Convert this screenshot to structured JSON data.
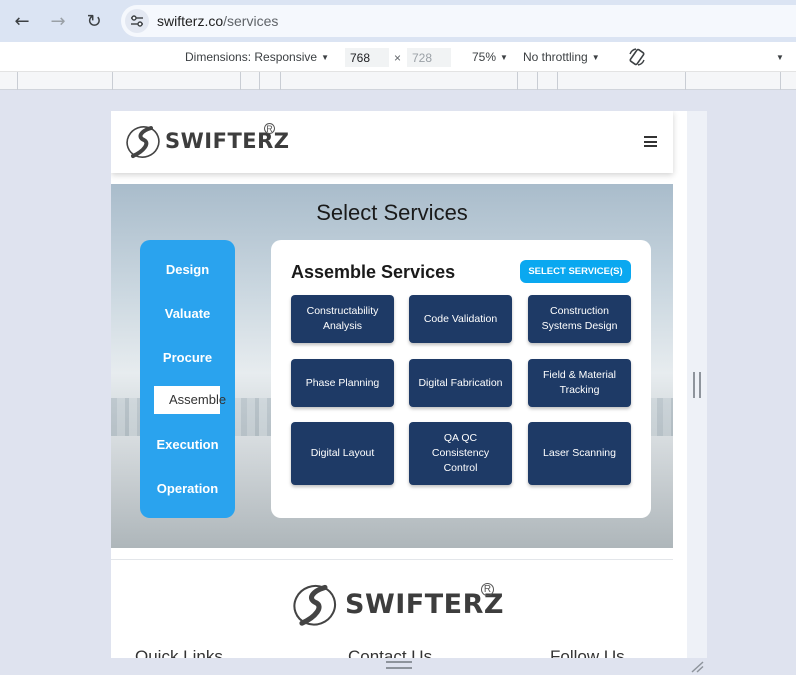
{
  "browser": {
    "url_host": "swifterz.co",
    "url_path": "/services",
    "back_icon": "←",
    "forward_icon": "→",
    "reload_icon": "↻"
  },
  "devtools": {
    "dimensions_label": "Dimensions: Responsive",
    "width_value": "768",
    "times": "×",
    "height_placeholder": "728",
    "zoom": "75%",
    "throttling": "No throttling"
  },
  "site": {
    "logo_text": "SWIFTERZ",
    "logo_reg": "R",
    "hero_title": "Select Services",
    "nav_items": [
      "Design",
      "Valuate",
      "Procure",
      "Assemble",
      "Execution",
      "Operation"
    ],
    "active_index": 3,
    "panel_title": "Assemble Services",
    "select_button": "SELECT SERVICE(S)",
    "services": [
      "Constructability Analysis",
      "Code Validation",
      "Construction Systems Design",
      "Phase Planning",
      "Digital Fabrication",
      "Field & Material Tracking",
      "Digital Layout",
      "QA QC Consistency Control",
      "Laser Scanning"
    ],
    "footer_headings": [
      "Quick Links",
      "Contact Us",
      "Follow Us"
    ]
  },
  "colors": {
    "nav_blue": "#2aa3ee",
    "service_navy": "#1e3a66",
    "select_button": "#0aa8f0"
  }
}
